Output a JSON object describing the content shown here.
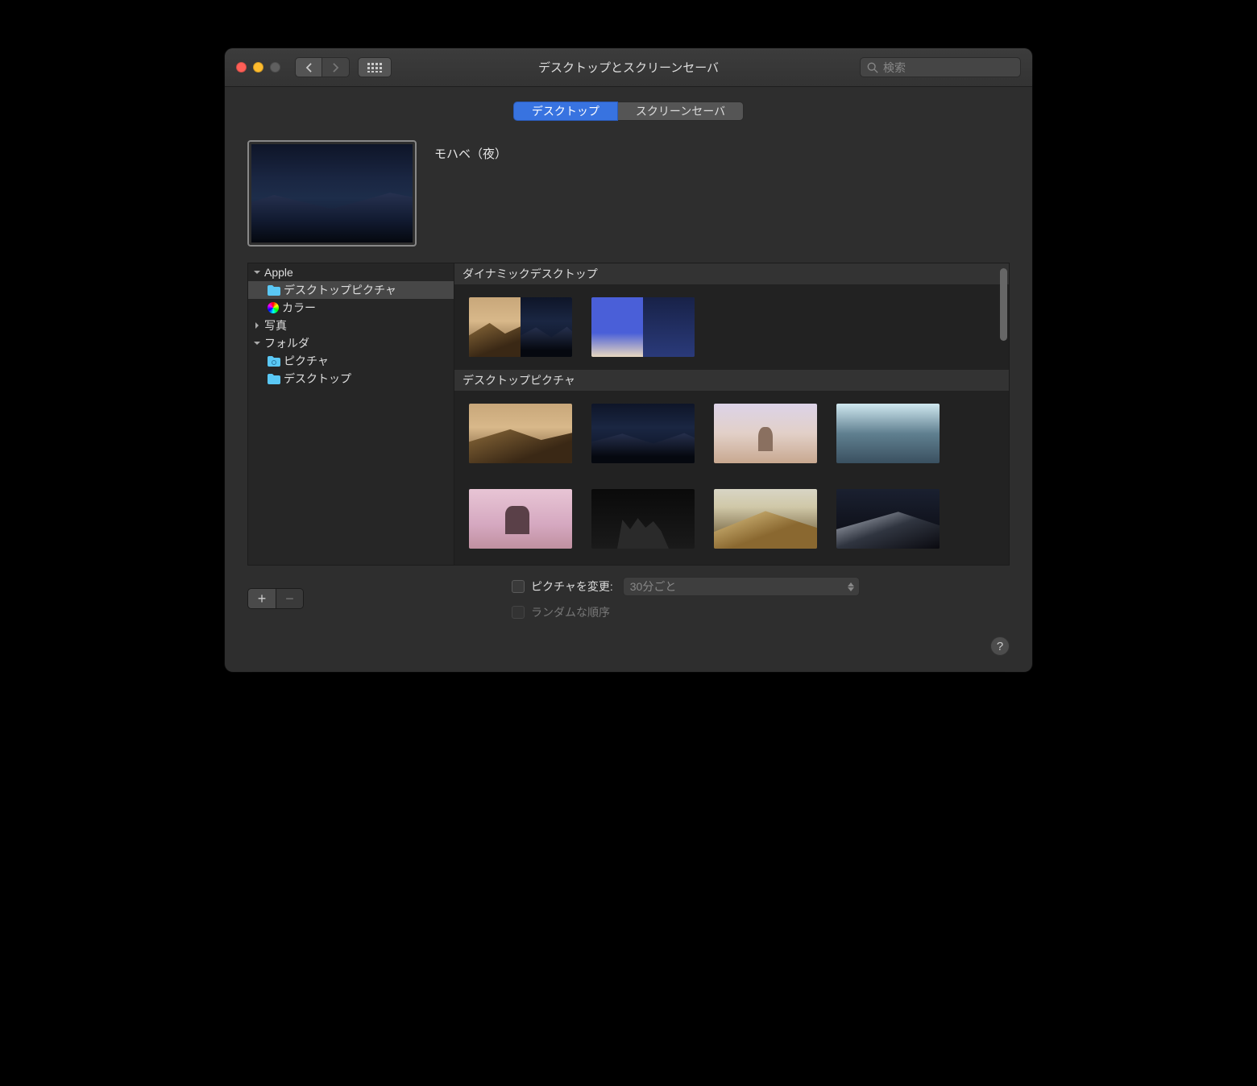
{
  "window": {
    "title": "デスクトップとスクリーンセーバ"
  },
  "search": {
    "placeholder": "検索"
  },
  "tabs": {
    "desktop": "デスクトップ",
    "screensaver": "スクリーンセーバ"
  },
  "preview": {
    "label": "モハベ（夜）"
  },
  "sidebar": {
    "apple": "Apple",
    "desktop_pictures": "デスクトップピクチャ",
    "colors": "カラー",
    "photos": "写真",
    "folders": "フォルダ",
    "pictures": "ピクチャ",
    "desktop_folder": "デスクトップ"
  },
  "sections": {
    "dynamic": "ダイナミックデスクトップ",
    "desktop_pictures": "デスクトップピクチャ"
  },
  "controls": {
    "change_picture": "ピクチャを変更:",
    "random_order": "ランダムな順序",
    "interval": "30分ごと",
    "help": "?"
  }
}
